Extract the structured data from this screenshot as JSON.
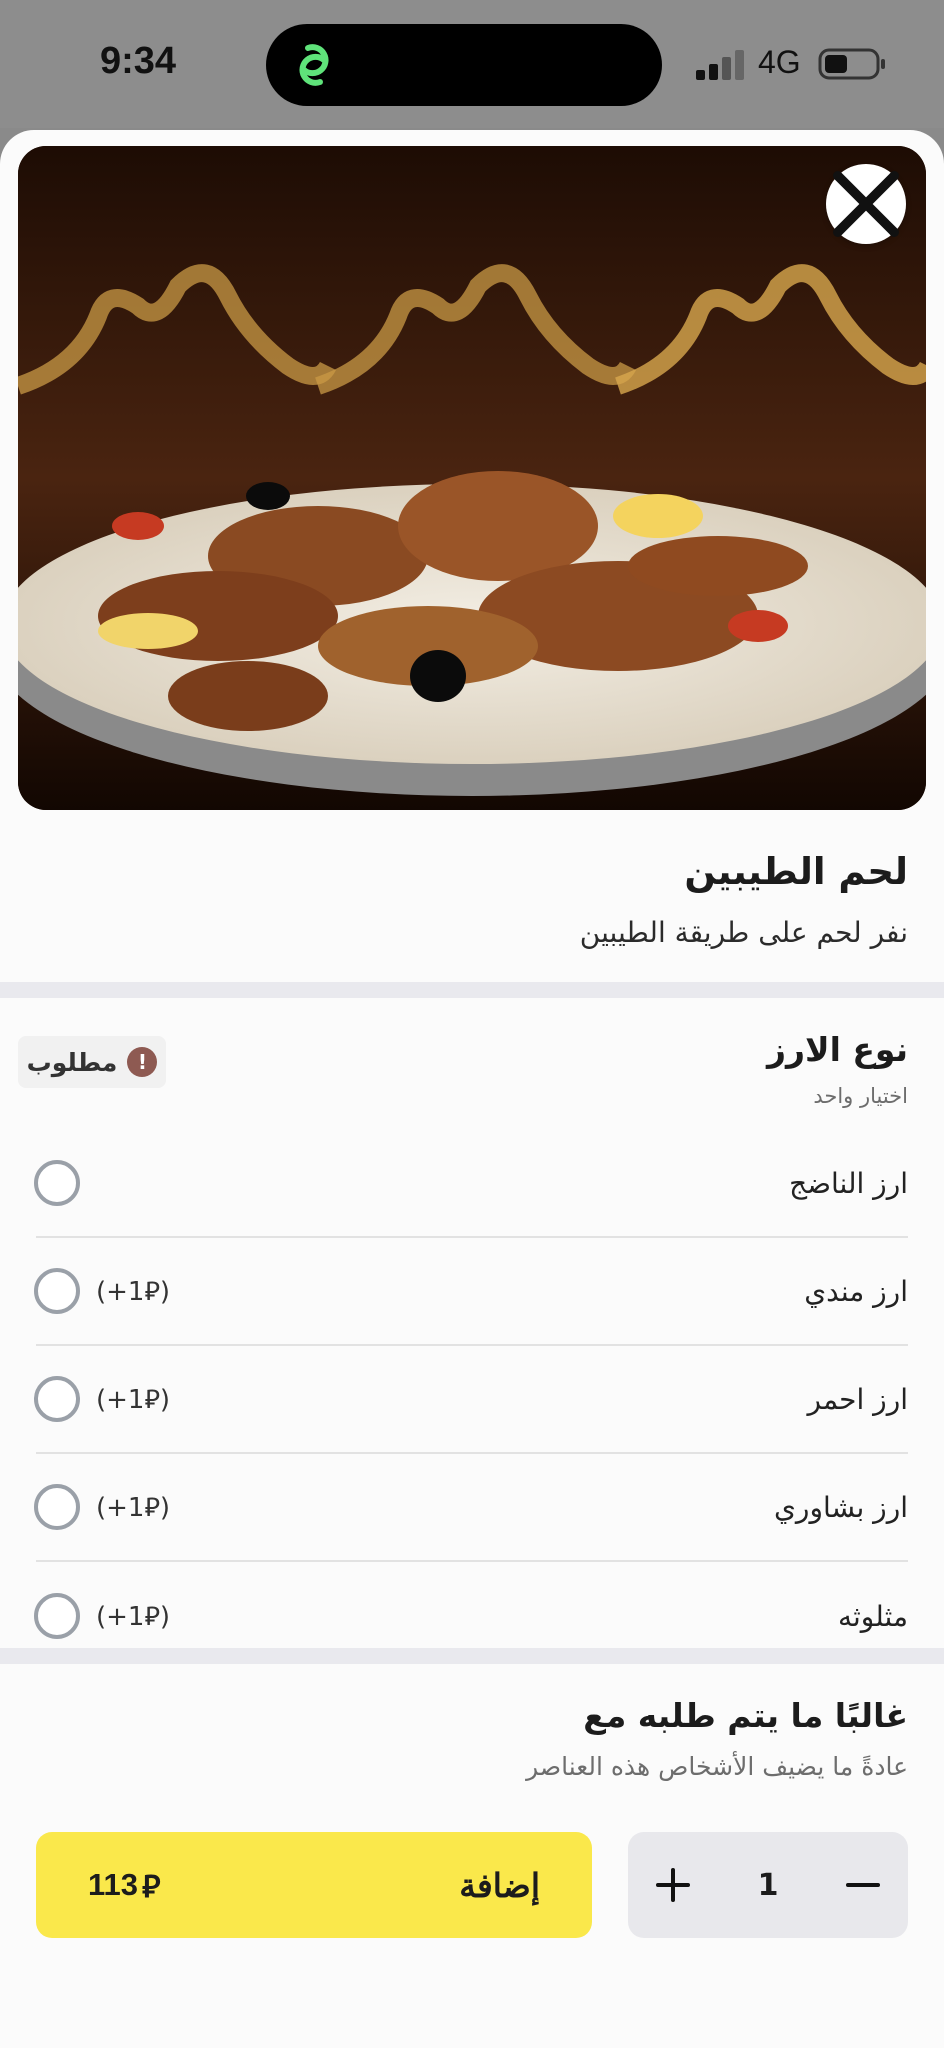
{
  "status_bar": {
    "time": "9:34",
    "network": "4G"
  },
  "hero_image": {
    "alt_icon": "close-icon"
  },
  "item": {
    "title": "لحم الطيبين",
    "description": "نفر لحم على طريقة الطيبين"
  },
  "rice_section": {
    "title": "نوع الارز",
    "subtitle": "اختيار واحد",
    "required_label": "مطلوب",
    "options": [
      {
        "label": "ارز الناضج",
        "price": ""
      },
      {
        "label": "ارز مندي",
        "price": "(+1⃁)"
      },
      {
        "label": "ارز احمر",
        "price": "(+1⃁)"
      },
      {
        "label": "ارز بشاوري",
        "price": "(+1⃁)"
      },
      {
        "label": "مثلوثه",
        "price": "(+1⃁)"
      }
    ]
  },
  "upsell_section": {
    "title": "غالبًا ما يتم طلبه مع",
    "subtitle": "عادةً ما يضيف الأشخاص هذه العناصر"
  },
  "footer": {
    "quantity": "1",
    "add_label": "إضافة",
    "price": "113",
    "currency_symbol": "⃁"
  },
  "colors": {
    "accent_yellow": "#fae84b",
    "required_icon": "#8e5a52"
  }
}
